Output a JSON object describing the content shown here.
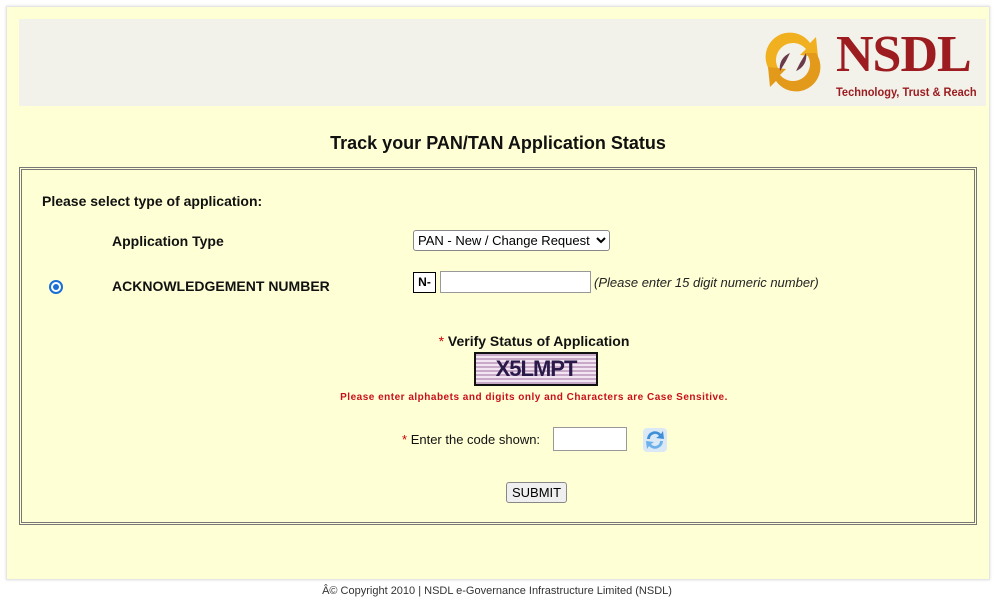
{
  "header": {
    "logo_text": "NSDL",
    "logo_tagline": "Technology, Trust & Reach"
  },
  "page_title": "Track your PAN/TAN Application Status",
  "form": {
    "select_type_label": "Please select type of application:",
    "application_type_label": "Application Type",
    "application_type_value": "PAN - New / Change Request",
    "ack_label": "ACKNOWLEDGEMENT NUMBER",
    "ack_prefix": "N-",
    "ack_value": "",
    "ack_hint": "(Please enter 15 digit numeric number)",
    "required_mark": "*",
    "verify_label": "Verify Status of Application",
    "captcha_text": "X5LMPT",
    "captcha_warning": "Please enter alphabets and digits only and Characters are Case Sensitive.",
    "code_label": "Enter the code shown:",
    "code_value": "",
    "submit_label": "SUBMIT"
  },
  "footer": {
    "copyright": "Â© Copyright 2010  |  NSDL e-Governance Infrastructure Limited (NSDL)"
  },
  "colors": {
    "background": "#ffffd6",
    "brand": "#9c1c20",
    "warning": "#c8101a"
  }
}
